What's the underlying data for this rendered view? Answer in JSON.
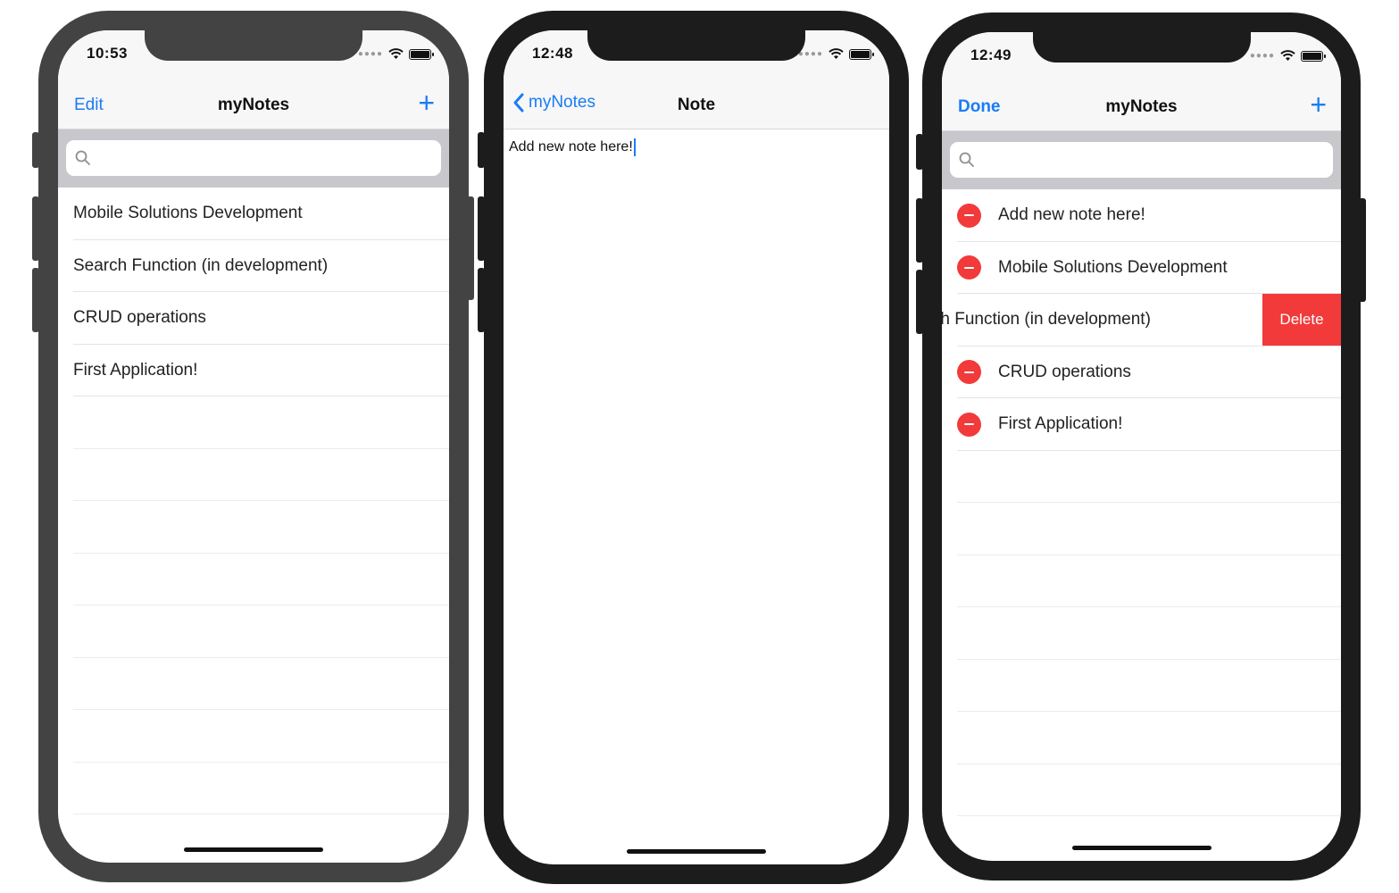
{
  "phones": [
    {
      "status": {
        "time": "10:53"
      },
      "nav": {
        "left": "Edit",
        "title": "myNotes",
        "right": "+"
      },
      "search": {
        "placeholder": ""
      },
      "notes": [
        "Mobile Solutions Development",
        "Search Function (in development)",
        "CRUD operations",
        "First Application!"
      ]
    },
    {
      "status": {
        "time": "12:48"
      },
      "nav": {
        "back": "myNotes",
        "title": "Note"
      },
      "note_body": "Add new note here!"
    },
    {
      "status": {
        "time": "12:49"
      },
      "nav": {
        "left": "Done",
        "title": "myNotes",
        "right": "+"
      },
      "search": {
        "placeholder": ""
      },
      "notes": [
        "Add new note here!",
        "Mobile Solutions Development",
        "arch Function (in development)",
        "CRUD operations",
        "First Application!"
      ],
      "delete_label": "Delete"
    }
  ],
  "colors": {
    "accent": "#1a7cf5",
    "destructive": "#f23a3a",
    "searchbar_bg": "#c8c8cc"
  }
}
